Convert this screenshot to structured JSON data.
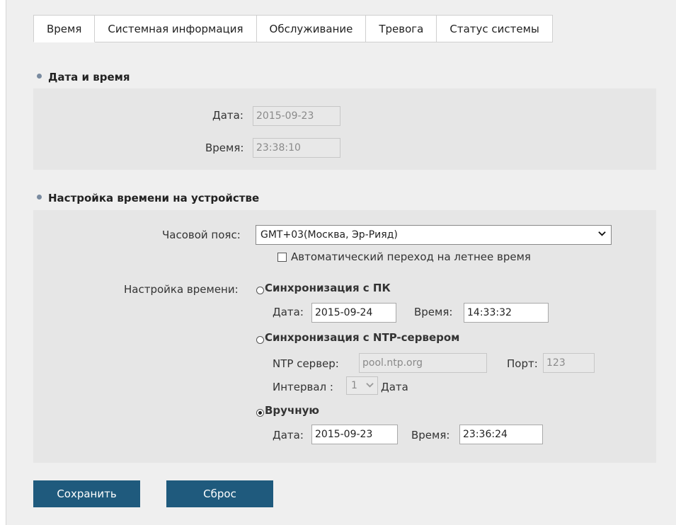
{
  "tabs": [
    {
      "label": "Время",
      "active": true
    },
    {
      "label": "Системная информация",
      "active": false
    },
    {
      "label": "Обслуживание",
      "active": false
    },
    {
      "label": "Тревога",
      "active": false
    },
    {
      "label": "Статус системы",
      "active": false
    }
  ],
  "datetime": {
    "title": "Дата и время",
    "date_label": "Дата:",
    "date_value": "2015-09-23",
    "time_label": "Время:",
    "time_value": "23:38:10"
  },
  "device_time": {
    "title": "Настройка времени на устройстве",
    "timezone_label": "Часовой пояс:",
    "timezone_value": "GMT+03(Москва, Эр-Рияд)",
    "dst_label": "Автоматический переход на летнее время",
    "dst_checked": false,
    "settings_label": "Настройка времени:",
    "sync_pc": {
      "label": "Синхронизация с ПК",
      "date_label": "Дата:",
      "date_value": "2015-09-24",
      "time_label": "Время:",
      "time_value": "14:33:32"
    },
    "sync_ntp": {
      "label": "Синхронизация с NTP-сервером",
      "server_label": "NTP сервер:",
      "server_value": "pool.ntp.org",
      "port_label": "Порт:",
      "port_value": "123",
      "interval_label": "Интервал :",
      "interval_value": "1",
      "interval_unit": "Дата"
    },
    "manual": {
      "label": "Вручную",
      "date_label": "Дата:",
      "date_value": "2015-09-23",
      "time_label": "Время:",
      "time_value": "23:36:24"
    },
    "selected_mode": "manual"
  },
  "buttons": {
    "save": "Сохранить",
    "reset": "Сброс"
  },
  "colors": {
    "button": "#1f5a7d",
    "panel": "#e6e6e6",
    "background": "#efefef"
  }
}
